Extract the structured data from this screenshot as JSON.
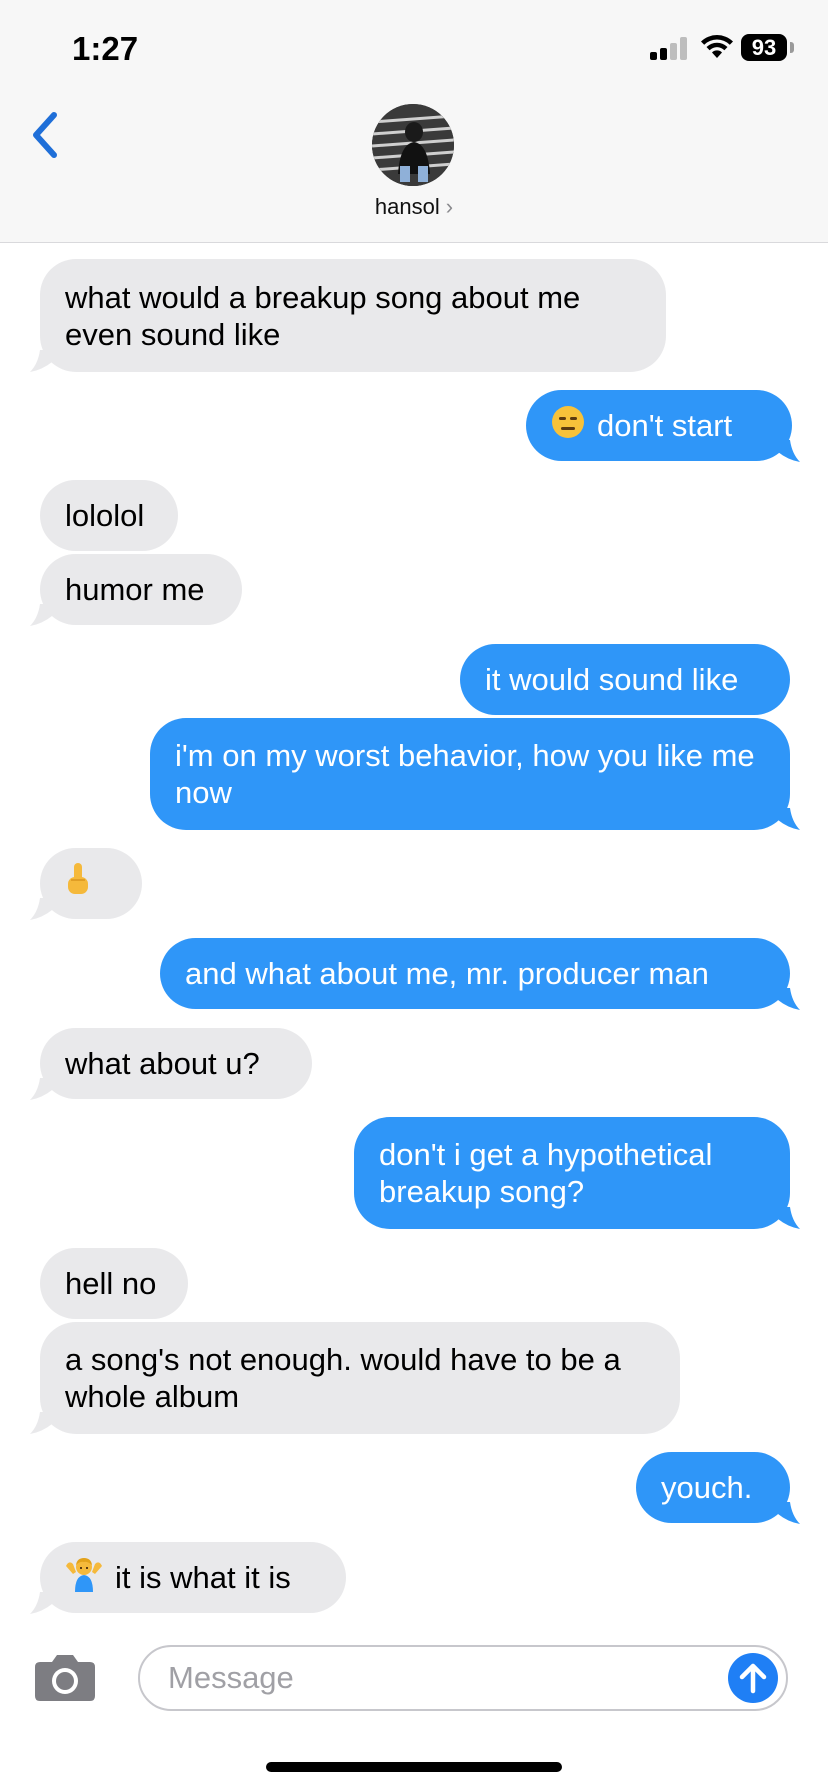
{
  "status_bar": {
    "time": "1:27",
    "battery": "93"
  },
  "header": {
    "contact_name": "hansol",
    "contact_chevron": "›"
  },
  "messages": [
    {
      "from": "them",
      "text": "what would a breakup song about me even sound like"
    },
    {
      "from": "me",
      "emoji": "😑",
      "text": "don't start"
    },
    {
      "from": "them",
      "text": "lololol"
    },
    {
      "from": "them",
      "text": "humor me"
    },
    {
      "from": "me",
      "text": "it would sound like"
    },
    {
      "from": "me",
      "text": "i'm on my worst behavior, how you like me now"
    },
    {
      "from": "them",
      "emoji": "🖕",
      "text": ""
    },
    {
      "from": "me",
      "text": "and what about me, mr. producer man"
    },
    {
      "from": "them",
      "text": "what about u?"
    },
    {
      "from": "me",
      "text": "don't i get a hypothetical breakup song?"
    },
    {
      "from": "them",
      "text": "hell no"
    },
    {
      "from": "them",
      "text": "a song's not enough. would have to be a whole album"
    },
    {
      "from": "me",
      "text": "youch."
    },
    {
      "from": "them",
      "emoji": "🤷‍♂️",
      "text": "it is what it is"
    }
  ],
  "composer": {
    "placeholder": "Message"
  },
  "icons": {
    "back": "chevron-left-icon",
    "camera": "camera-icon",
    "send": "arrow-up-icon",
    "signal": "cellular-signal-icon",
    "wifi": "wifi-icon",
    "battery": "battery-icon"
  },
  "colors": {
    "outgoing_bubble": "#2f96f8",
    "incoming_bubble": "#e9e9eb",
    "accent": "#1f7ff5"
  }
}
